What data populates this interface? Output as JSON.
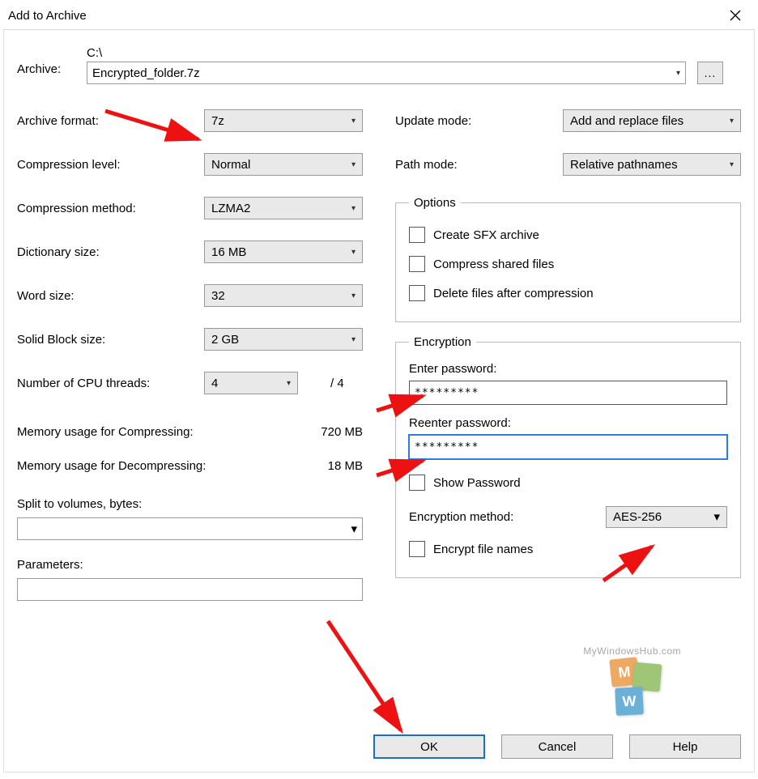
{
  "window": {
    "title": "Add to Archive"
  },
  "archive": {
    "label": "Archive:",
    "path": "C:\\",
    "name": "Encrypted_folder.7z",
    "browse": "..."
  },
  "left": {
    "format_lbl": "Archive format:",
    "format_val": "7z",
    "level_lbl": "Compression level:",
    "level_val": "Normal",
    "method_lbl": "Compression method:",
    "method_val": "LZMA2",
    "dict_lbl": "Dictionary size:",
    "dict_val": "16 MB",
    "word_lbl": "Word size:",
    "word_val": "32",
    "solid_lbl": "Solid Block size:",
    "solid_val": "2 GB",
    "cpu_lbl": "Number of CPU threads:",
    "cpu_val": "4",
    "cpu_total": "/ 4",
    "mem_c_lbl": "Memory usage for Compressing:",
    "mem_c_val": "720 MB",
    "mem_d_lbl": "Memory usage for Decompressing:",
    "mem_d_val": "18 MB",
    "split_lbl": "Split to volumes, bytes:",
    "params_lbl": "Parameters:"
  },
  "right": {
    "update_lbl": "Update mode:",
    "update_val": "Add and replace files",
    "path_lbl": "Path mode:",
    "path_val": "Relative pathnames",
    "options_legend": "Options",
    "opt_sfx": "Create SFX archive",
    "opt_shared": "Compress shared files",
    "opt_delete": "Delete files after compression",
    "enc_legend": "Encryption",
    "pw_lbl": "Enter password:",
    "pw_val": "*********",
    "pw2_lbl": "Reenter password:",
    "pw2_val": "*********",
    "show_pw": "Show Password",
    "enc_method_lbl": "Encryption method:",
    "enc_method_val": "AES-256",
    "enc_names": "Encrypt file names"
  },
  "buttons": {
    "ok": "OK",
    "cancel": "Cancel",
    "help": "Help"
  },
  "watermark": "MyWindowsHub.com"
}
